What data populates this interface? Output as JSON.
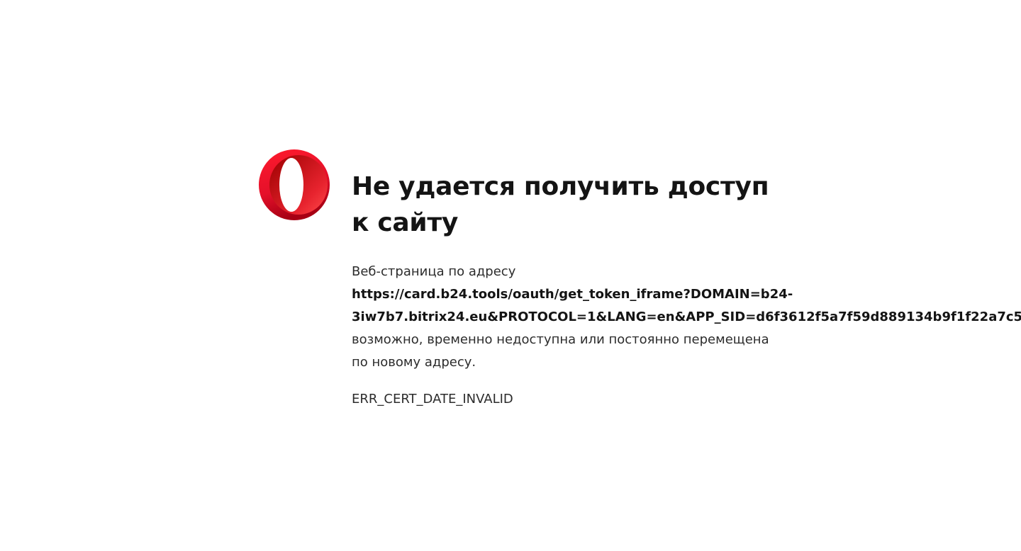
{
  "brand": {
    "logo_icon": "opera-logo-icon",
    "accent_color": "#e8102d"
  },
  "error_page": {
    "title": "Не удается получить доступ к сайту",
    "desc_intro": "Веб-страница по адресу",
    "url_line1": "https://card.b24.tools/oauth/get_token_iframe?DOMAIN=b24-",
    "url_line2": "3iw7b7.bitrix24.eu&PROTOCOL=1&LANG=en&APP_SID=d6f3612f5a7f59d889134b9f1f22a7c5",
    "url_suffix": ",",
    "desc_rest_line1": "возможно, временно недоступна или постоянно перемещена",
    "desc_rest_line2": "по новому адресу.",
    "error_code": "ERR_CERT_DATE_INVALID"
  }
}
